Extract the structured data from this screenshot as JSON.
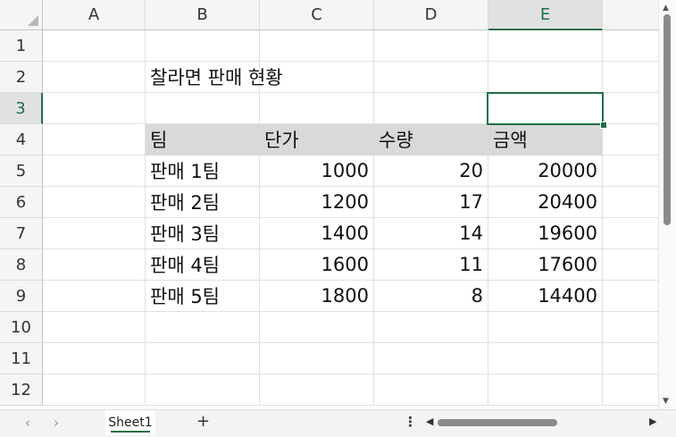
{
  "columns": [
    "A",
    "B",
    "C",
    "D",
    "E"
  ],
  "rows": [
    "1",
    "2",
    "3",
    "4",
    "5",
    "6",
    "7",
    "8",
    "9",
    "10",
    "11",
    "12"
  ],
  "selected_cell": {
    "column": "E",
    "row": "3"
  },
  "title": "찰라면 판매 현황",
  "table": {
    "headers": [
      "팀",
      "단가",
      "수량",
      "금액"
    ],
    "rows": [
      [
        "판매 1팀",
        "1000",
        "20",
        "20000"
      ],
      [
        "판매 2팀",
        "1200",
        "17",
        "20400"
      ],
      [
        "판매 3팀",
        "1400",
        "14",
        "19600"
      ],
      [
        "판매 4팀",
        "1600",
        "11",
        "17600"
      ],
      [
        "판매 5팀",
        "1800",
        "8",
        "14400"
      ]
    ]
  },
  "sheet_tabs": [
    "Sheet1"
  ],
  "add_sheet": "+",
  "nav_prev": "‹",
  "nav_next": "›",
  "more": "⋮",
  "scroll_left": "◀",
  "scroll_right": "▶",
  "scroll_up": "▲",
  "scroll_down": "▼",
  "accent_color": "#1e7145",
  "header_fill_color": "#d9d9d9"
}
